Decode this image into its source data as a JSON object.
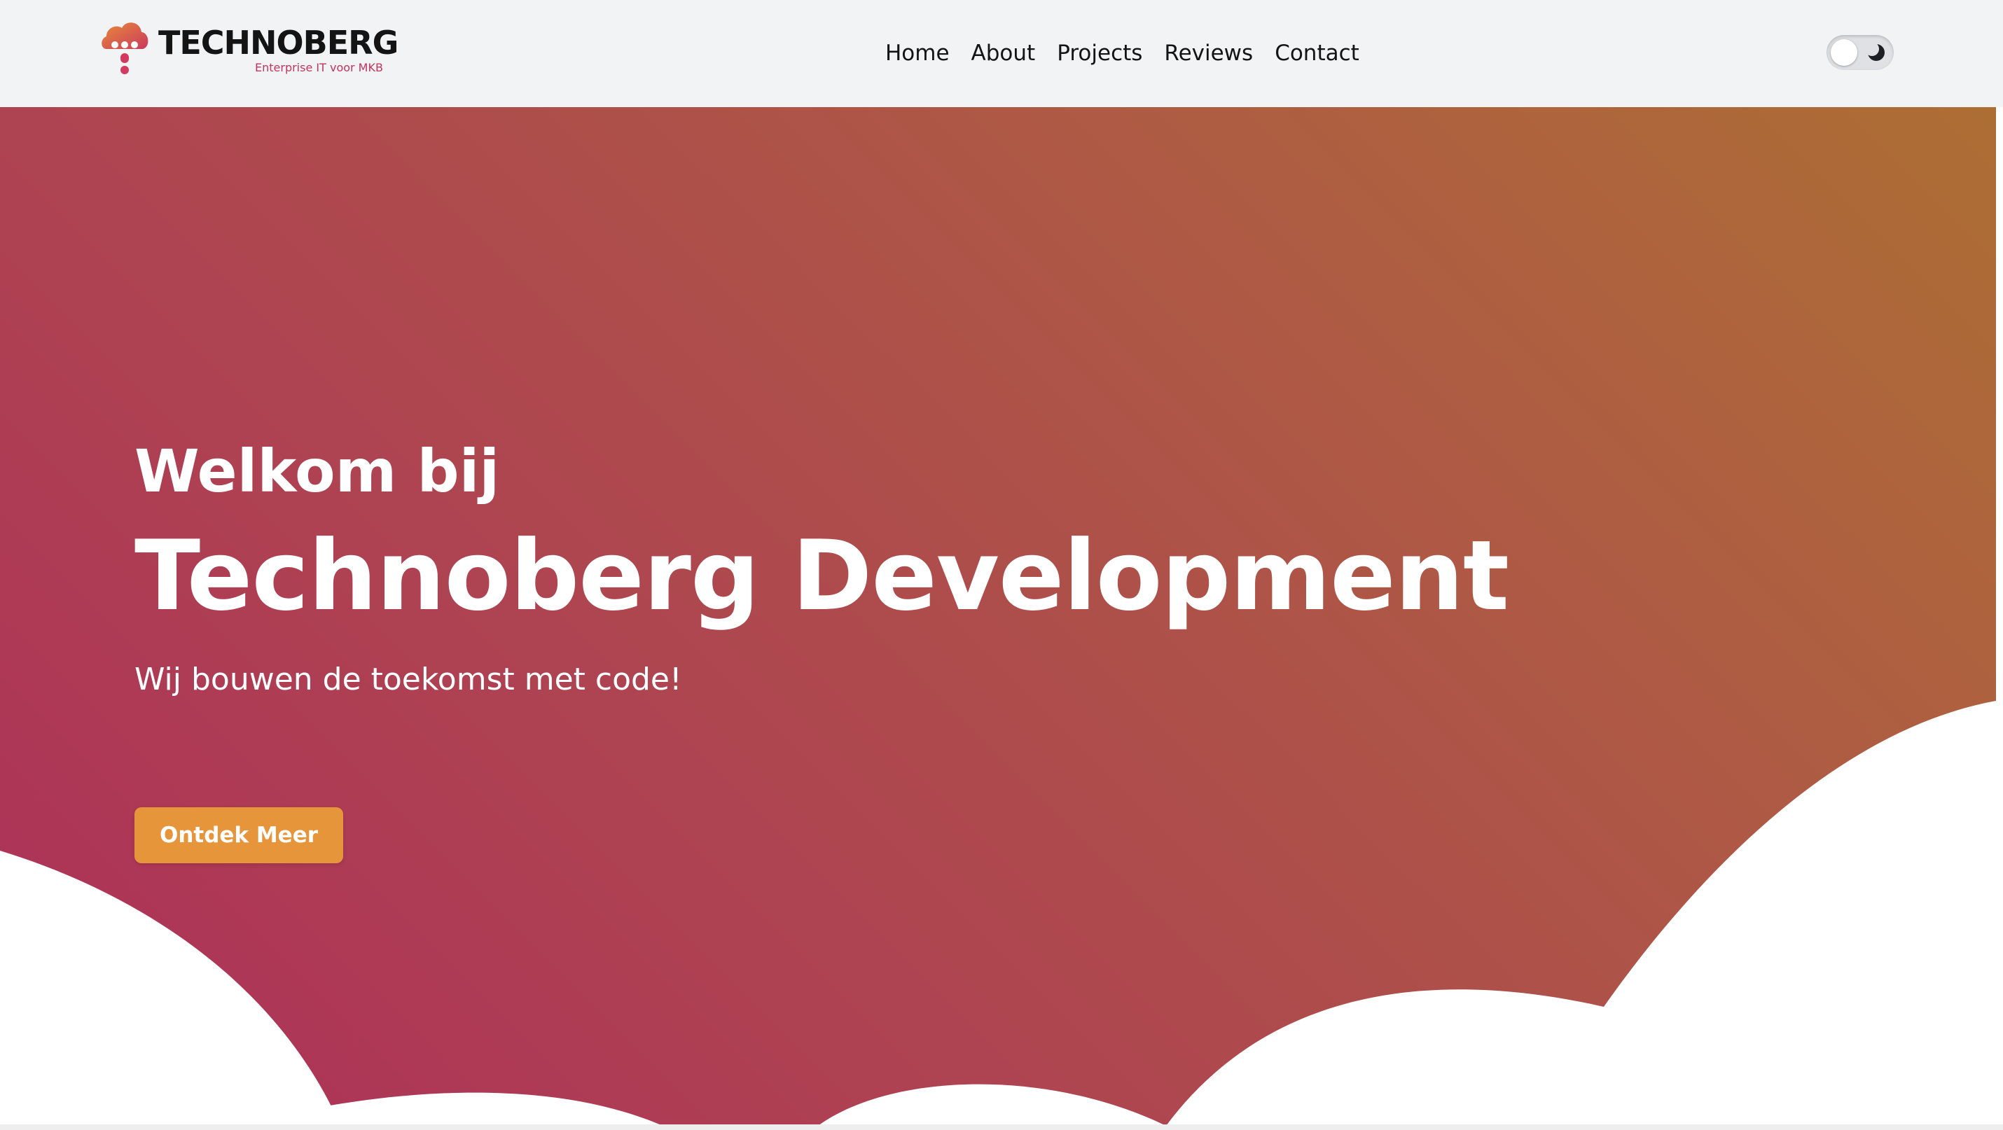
{
  "brand": {
    "name": "TECHNOBERG",
    "tagline": "Enterprise IT voor MKB",
    "logo_icon": "cloud-logo-icon"
  },
  "nav": {
    "items": [
      {
        "label": "Home"
      },
      {
        "label": "About"
      },
      {
        "label": "Projects"
      },
      {
        "label": "Reviews"
      },
      {
        "label": "Contact"
      }
    ]
  },
  "theme_toggle": {
    "icon": "moon-icon",
    "state": "light"
  },
  "hero": {
    "greeting": "Welkom bij",
    "title": "Technoberg Development",
    "subtitle": "Wij bouwen de toekomst met code!",
    "cta_label": "Ontdek Meer"
  },
  "colors": {
    "accent": "#e7953b",
    "brand_pink": "#c4345c",
    "gradient_start": "#ad6e34",
    "gradient_end": "#ad2f5a",
    "header_bg": "#f2f3f5"
  }
}
